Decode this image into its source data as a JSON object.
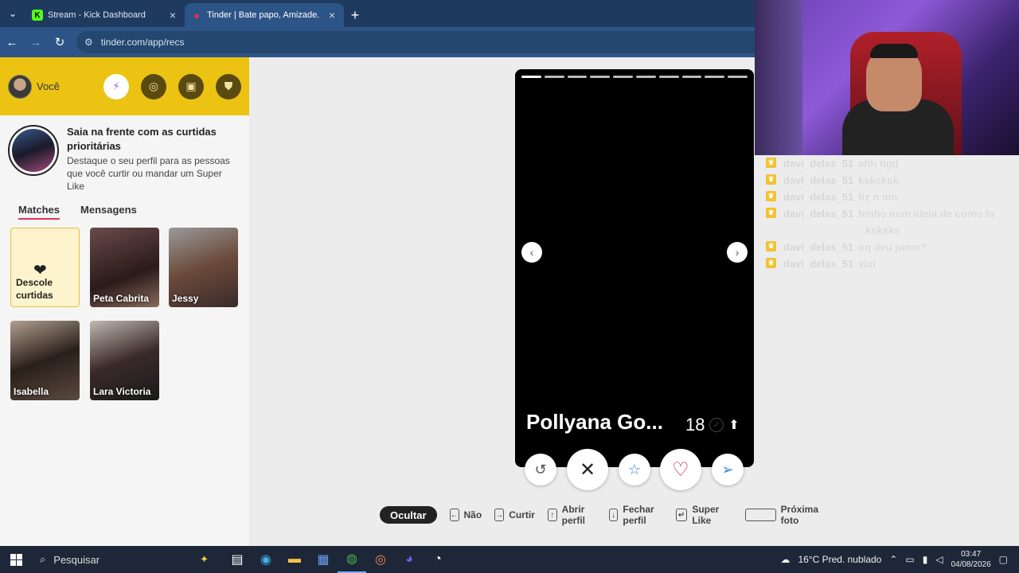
{
  "browser": {
    "tabs": [
      {
        "title": "Stream - Kick Dashboard",
        "favicon": "K"
      },
      {
        "title": "Tinder | Bate papo, Amizade. En",
        "favicon": "flame"
      }
    ],
    "url": "tinder.com/app/recs"
  },
  "sidebar": {
    "user_label": "Você",
    "promo_title": "Saia na frente com as curtidas prioritárias",
    "promo_sub": "Destaque o seu perfil para as pessoas que você curtir ou mandar um Super Like",
    "tab_matches": "Matches",
    "tab_messages": "Mensagens",
    "likes_card": "Descole curtidas",
    "matches": [
      "Peta Cabrita",
      "Jessy",
      "Isabella",
      "Lara Victoria"
    ]
  },
  "profile": {
    "name": "Pollyana Go...",
    "age": "18",
    "photo_index": 1,
    "photo_count": 10
  },
  "shortcuts": {
    "hide": "Ocultar",
    "no": "Não",
    "like": "Curtir",
    "open": "Abrir perfil",
    "close": "Fechar perfil",
    "superlike": "Super Like",
    "next_photo": "Próxima foto"
  },
  "chat": [
    {
      "user": "davi_delas_51",
      "text": "ahh tlgd",
      "cont": ""
    },
    {
      "user": "davi_delas_51",
      "text": "ksksksk",
      "cont": ""
    },
    {
      "user": "davi_delas_51",
      "text": "fiz n mn",
      "cont": ""
    },
    {
      "user": "davi_delas_51",
      "text": "tenho nem ideia de como fa",
      "cont": "ksksks"
    },
    {
      "user": "davi_delas_51",
      "text": "oq deu junin?",
      "cont": ""
    },
    {
      "user": "davi_delas_51",
      "text": "vixi",
      "cont": ""
    }
  ],
  "taskbar": {
    "search": "Pesquisar",
    "weather": "16°C  Pred. nublado",
    "time": "03:47",
    "date": "04/08/2026"
  },
  "colors": {
    "tinder_yellow": "#ecc312",
    "browser_blue": "#2d5486",
    "heart": "#e0325c"
  }
}
